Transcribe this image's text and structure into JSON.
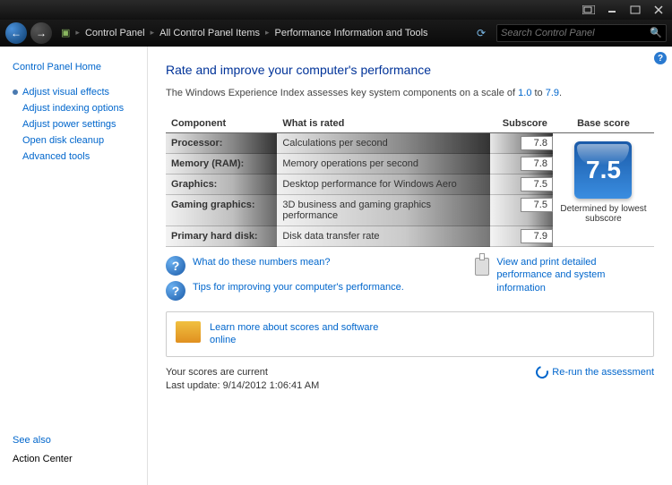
{
  "titlebar": {},
  "nav": {
    "breadcrumb": [
      "Control Panel",
      "All Control Panel Items",
      "Performance Information and Tools"
    ],
    "search_placeholder": "Search Control Panel"
  },
  "sidebar": {
    "home": "Control Panel Home",
    "items": [
      "Adjust visual effects",
      "Adjust indexing options",
      "Adjust power settings",
      "Open disk cleanup",
      "Advanced tools"
    ],
    "seealso_label": "See also",
    "seealso_link": "Action Center"
  },
  "main": {
    "title": "Rate and improve your computer's performance",
    "desc_pre": "The Windows Experience Index assesses key system components on a scale of ",
    "desc_low": "1.0",
    "desc_mid": " to ",
    "desc_high": "7.9",
    "desc_post": ".",
    "headers": {
      "component": "Component",
      "rated": "What is rated",
      "subscore": "Subscore",
      "base": "Base score"
    },
    "rows": [
      {
        "component": "Processor:",
        "rated": "Calculations per second",
        "subscore": "7.8"
      },
      {
        "component": "Memory (RAM):",
        "rated": "Memory operations per second",
        "subscore": "7.8"
      },
      {
        "component": "Graphics:",
        "rated": "Desktop performance for Windows Aero",
        "subscore": "7.5"
      },
      {
        "component": "Gaming graphics:",
        "rated": "3D business and gaming graphics performance",
        "subscore": "7.5"
      },
      {
        "component": "Primary hard disk:",
        "rated": "Disk data transfer rate",
        "subscore": "7.9"
      }
    ],
    "base_score": "7.5",
    "base_label": "Determined by lowest subscore",
    "link_numbers": "What do these numbers mean?",
    "link_tips": "Tips for improving your computer's performance.",
    "link_print": "View and print detailed performance and system information",
    "link_learn": "Learn more about scores and software online",
    "status_current": "Your scores are current",
    "status_update": "Last update: 9/14/2012 1:06:41 AM",
    "rerun": "Re-run the assessment"
  }
}
